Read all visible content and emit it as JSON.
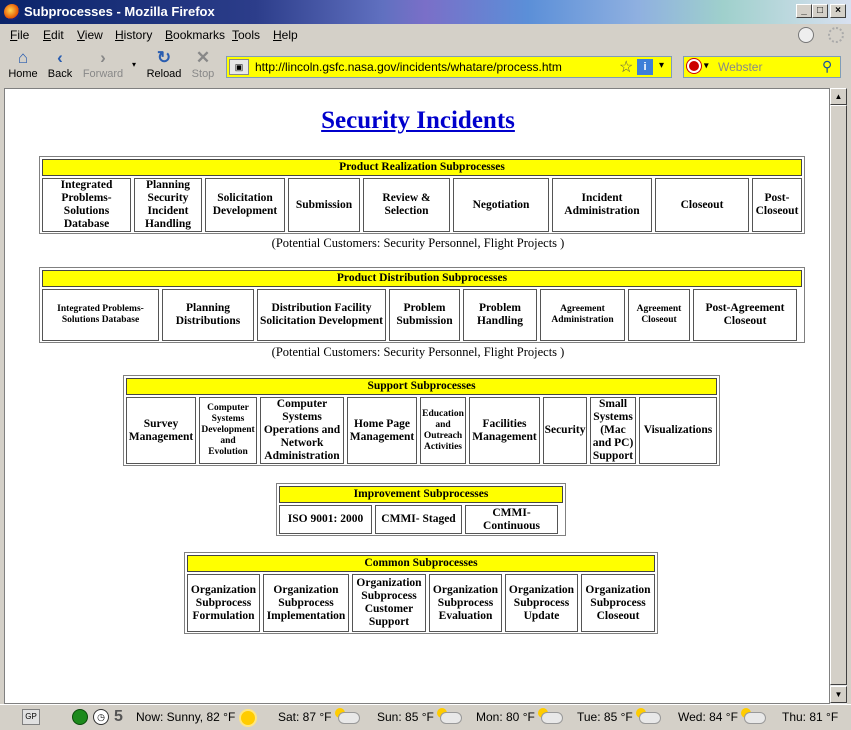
{
  "window": {
    "title": "Subprocesses - Mozilla Firefox"
  },
  "menu": [
    "File",
    "Edit",
    "View",
    "History",
    "Bookmarks",
    "Tools",
    "Help"
  ],
  "nav": {
    "home": "Home",
    "back": "Back",
    "forward": "Forward",
    "reload": "Reload",
    "stop": "Stop"
  },
  "url": "http://lincoln.gsfc.nasa.gov/incidents/whatare/process.htm",
  "search": {
    "placeholder": "Webster"
  },
  "page": {
    "title": "Security Incidents",
    "sections": [
      {
        "header": "Product Realization Subprocesses",
        "cells": [
          "Integrated Problems-Solutions Database",
          "Planning Security Incident Handling",
          "Solicitation Development",
          "Submission",
          "Review & Selection",
          "Negotiation",
          "Incident Administration",
          "Closeout",
          "Post-Closeout"
        ],
        "note": "(Potential Customers: Security Personnel, Flight Projects )"
      },
      {
        "header": "Product Distribution Subprocesses",
        "cells": [
          "Integrated Problems-Solutions Database",
          "Planning Distributions",
          "Distribution Facility Solicitation Development",
          "Problem Submission",
          "Problem Handling",
          "Agreement Administration",
          "Agreement Closeout",
          "Post-Agreement Closeout"
        ],
        "note": "(Potential Customers: Security Personnel, Flight Projects )"
      },
      {
        "header": "Support Subprocesses",
        "cells": [
          "Survey Management",
          "Computer Systems Development and Evolution",
          "Computer Systems Operations and Network Administration",
          "Home Page Management",
          "Education and Outreach Activities",
          "Facilities Management",
          "Security",
          "Small Systems (Mac and PC) Support",
          "Visualizations"
        ]
      },
      {
        "header": "Improvement Subprocesses",
        "cells": [
          "ISO 9001: 2000",
          "CMMI- Staged",
          "CMMI- Continuous"
        ]
      },
      {
        "header": "Common Subprocesses",
        "cells": [
          "Organization Subprocess Formulation",
          "Organization Subprocess Implementation",
          "Organization Subprocess Customer Support",
          "Organization Subprocess Evaluation",
          "Organization Subprocess Update",
          "Organization Subprocess Closeout"
        ]
      }
    ]
  },
  "status": {
    "gp": "GP",
    "counter": "5",
    "weather": [
      {
        "label": "Now: Sunny, 82 °F",
        "icon": "sun-icon"
      },
      {
        "label": "Sat: 87 °F",
        "icon": "partly-cloudy-icon"
      },
      {
        "label": "Sun: 85 °F",
        "icon": "partly-cloudy-icon"
      },
      {
        "label": "Mon: 80 °F",
        "icon": "partly-cloudy-icon"
      },
      {
        "label": "Tue: 85 °F",
        "icon": "partly-cloudy-icon"
      },
      {
        "label": "Wed: 84 °F",
        "icon": "partly-cloudy-icon"
      },
      {
        "label": "Thu: 81 °F",
        "icon": "partly-cloudy-icon"
      }
    ]
  }
}
